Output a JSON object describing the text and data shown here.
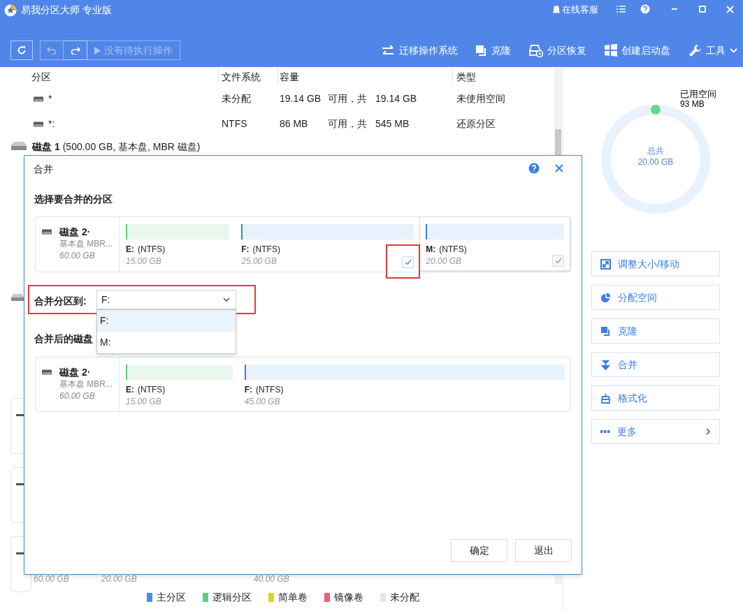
{
  "window": {
    "title": "易我分区大师 专业版",
    "support": "在线客服"
  },
  "toolbar": {
    "pending": "没有待执行操作",
    "actions": [
      {
        "label": "迁移操作系统",
        "kind": "migrate"
      },
      {
        "label": "克隆",
        "kind": "clone"
      },
      {
        "label": "分区恢复",
        "kind": "recover"
      },
      {
        "label": "创建启动盘",
        "kind": "boot"
      },
      {
        "label": "工具",
        "kind": "tools"
      }
    ]
  },
  "table": {
    "columns": [
      "分区",
      "文件系统",
      "容量",
      "类型"
    ],
    "rows": [
      {
        "name": "*",
        "fs": "未分配",
        "free": "19.14 GB",
        "mid": "可用，共",
        "total": "19.14 GB",
        "type": "未使用空间"
      },
      {
        "name": "*:",
        "fs": "NTFS",
        "free": "86 MB",
        "mid": "可用，共",
        "total": "545 MB",
        "type": "还原分区"
      }
    ],
    "disk": {
      "name": "磁盘 1",
      "info": "(500.00 GB, 基本盘, MBR 磁盘)"
    },
    "hidden_sizes": [
      "60.00 GB",
      "20.00 GB",
      "40.00 GB"
    ]
  },
  "dialog": {
    "title": "合并",
    "select_heading": "选择要合并的分区",
    "disk": {
      "name": "磁盘 2·",
      "type": "基本盘 MBR...",
      "size": "60.00 GB"
    },
    "partitions": [
      {
        "letter": "E:",
        "fs": "(NTFS)",
        "size": "15.00 GB",
        "kind": "logical"
      },
      {
        "letter": "F:",
        "fs": "(NTFS)",
        "size": "25.00 GB",
        "kind": "primary",
        "checked": true,
        "disabled": false
      },
      {
        "letter": "M:",
        "fs": "(NTFS)",
        "size": "20.00 GB",
        "kind": "primary",
        "checked": true,
        "disabled": true
      }
    ],
    "merge_label": "合并分区到:",
    "merge_value": "F:",
    "options": [
      {
        "label": "F:",
        "selected": true
      },
      {
        "label": "M:",
        "selected": false
      }
    ],
    "result_heading": "合并后的磁盘",
    "result_disk": {
      "name": "磁盘 2·",
      "type": "基本盘 MBR...",
      "size": "60.00 GB"
    },
    "result": [
      {
        "letter": "E:",
        "fs": "(NTFS)",
        "size": "15.00 GB",
        "kind": "logical"
      },
      {
        "letter": "F:",
        "fs": "(NTFS)",
        "size": "45.00 GB",
        "kind": "primary"
      }
    ],
    "buttons": [
      "确定",
      "退出"
    ]
  },
  "side": {
    "used_label": "已用空间",
    "used": "93 MB",
    "total_label": "总共",
    "total": "20.00 GB",
    "actions": [
      {
        "label": "调整大小/移动",
        "kind": "resize"
      },
      {
        "label": "分配空间",
        "kind": "allocate"
      },
      {
        "label": "克隆",
        "kind": "clone"
      },
      {
        "label": "合并",
        "kind": "merge"
      },
      {
        "label": "格式化",
        "kind": "format"
      },
      {
        "label": "更多",
        "kind": "more"
      }
    ]
  },
  "legend": [
    {
      "label": "主分区",
      "color": "#4a8ff0"
    },
    {
      "label": "逻辑分区",
      "color": "#5ccc7e"
    },
    {
      "label": "简单卷",
      "color": "#d4d62a"
    },
    {
      "label": "镜像卷",
      "color": "#e8617a"
    },
    {
      "label": "未分配",
      "color": "#e6e6e6"
    }
  ]
}
